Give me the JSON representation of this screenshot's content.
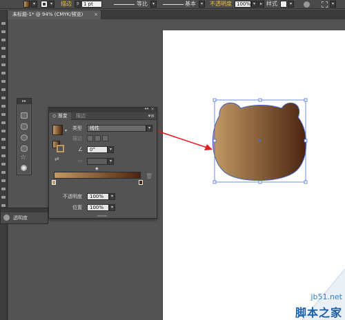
{
  "control_bar": {
    "stroke_label": "描边",
    "stroke_weight": "1 pt",
    "profile_label": "等比",
    "brush_label": "基本",
    "opacity_label": "不透明度",
    "opacity_value": "100%",
    "style_label": "样式"
  },
  "document": {
    "tab_title": "未标题-1* @ 94% (CMYK/预览)",
    "tab_close": "×"
  },
  "shape_panel": {
    "collapse_glyph": "▸▸"
  },
  "gradient_panel": {
    "tab_gradient": "渐变",
    "tab_stroke": "描边",
    "type_label": "类型",
    "type_value": "线性",
    "stroke_label": "描边",
    "angle_value": "0°",
    "opacity_label": "不透明度",
    "opacity_value": "100%",
    "location_label": "位置",
    "location_value": "100%",
    "gradient_colors": [
      "#c39a65",
      "#4a2410"
    ]
  },
  "transparency_panel": {
    "title": "透明度"
  },
  "artwork": {
    "gradient_colors": [
      "#c39a65",
      "#4a2410"
    ],
    "arrow_color": "#e02020"
  },
  "watermark": {
    "url": "jb51.net",
    "title": "脚本之家"
  }
}
